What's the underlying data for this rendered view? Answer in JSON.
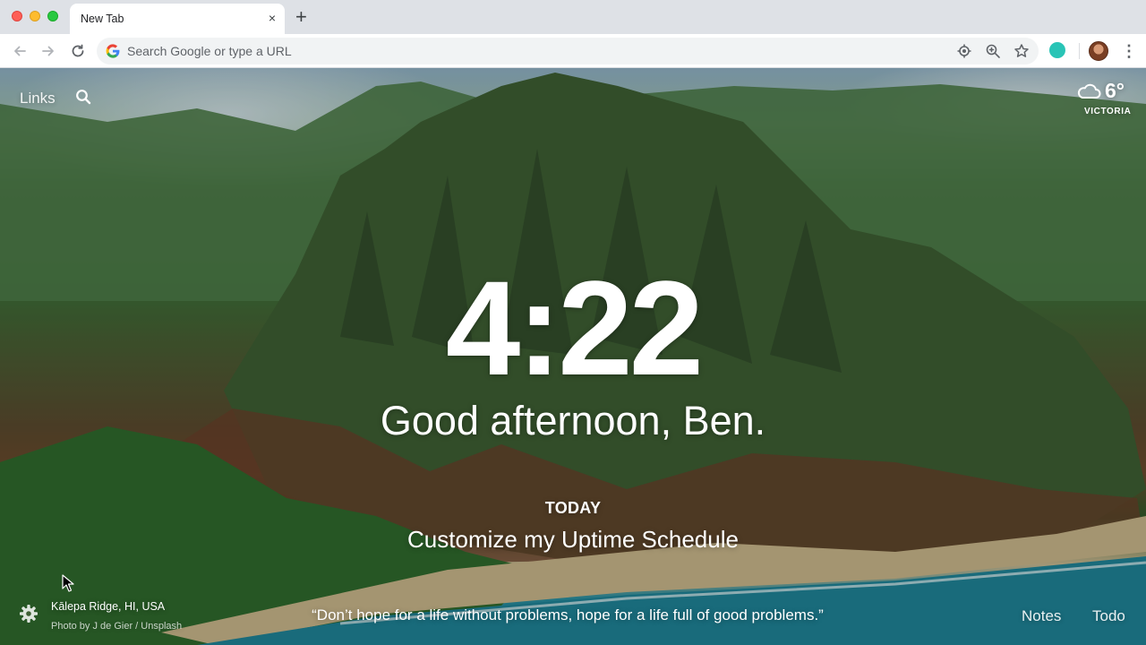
{
  "browser": {
    "tab_title": "New Tab",
    "tab_close": "×",
    "new_tab": "+",
    "omnibox_placeholder": "Search Google or type a URL",
    "menu": "⋮"
  },
  "header": {
    "links_label": "Links",
    "weather_temp": "6°",
    "weather_location": "VICTORIA"
  },
  "main": {
    "clock": "4:22",
    "greeting": "Good afternoon, Ben.",
    "today_label": "TODAY",
    "focus": "Customize my Uptime Schedule"
  },
  "footer": {
    "location": "Kālepa Ridge, HI, USA",
    "photo_credit": "Photo by J de Gier / Unsplash",
    "quote": "“Don’t hope for a life without problems, hope for a life full of good problems.”",
    "notes_label": "Notes",
    "todo_label": "Todo"
  },
  "colors": {
    "tabstrip": "#dee1e6",
    "extension_accent": "#29c4b6",
    "text": "#ffffff"
  }
}
